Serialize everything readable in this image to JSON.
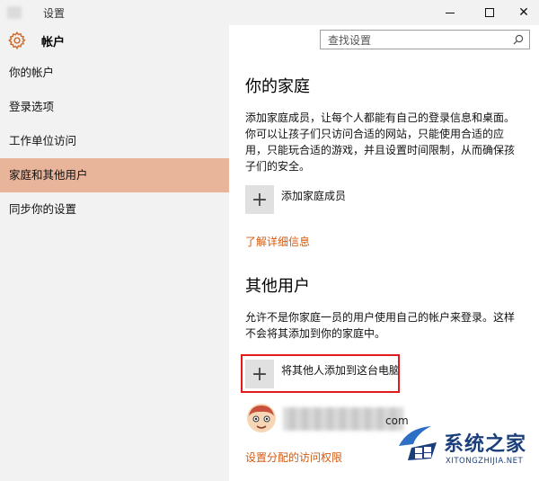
{
  "window": {
    "title": "设置",
    "controls": {
      "minimize": "minimize-icon",
      "maximize": "maximize-icon",
      "close": "✕"
    }
  },
  "sidebar": {
    "section_icon": "gear-icon",
    "section_title": "帐户",
    "items": [
      {
        "label": "你的帐户",
        "active": false
      },
      {
        "label": "登录选项",
        "active": false
      },
      {
        "label": "工作单位访问",
        "active": false
      },
      {
        "label": "家庭和其他用户",
        "active": true
      },
      {
        "label": "同步你的设置",
        "active": false
      }
    ]
  },
  "search": {
    "placeholder": "查找设置",
    "icon": "search-icon"
  },
  "family": {
    "heading": "你的家庭",
    "description_lines": [
      "添加家庭成员，让每个人都能有自己的登录信息和桌面。",
      "你可以让孩子们只访问合适的网站，只能使用合适的应",
      "用，只能玩合适的游戏，并且设置时间限制，从而确保孩",
      "子们的安全。"
    ],
    "add_button_icon": "+",
    "add_button_label": "添加家庭成员",
    "learn_more_link": "了解详细信息"
  },
  "others": {
    "heading": "其他用户",
    "description_lines": [
      "允许不是你家庭一员的用户使用自己的帐户来登录。这样",
      "不会将其添加到你的家庭中。"
    ],
    "add_button_icon": "+",
    "add_button_label": "将其他人添加到这台电脑",
    "user_email_suffix": "com",
    "assigned_access_link": "设置分配的访问权限"
  },
  "watermark": {
    "title": "系统之家",
    "url": "XITONGZHIJIA.NET"
  },
  "colors": {
    "accent_link": "#d45a10",
    "active_nav": "#e8b49a",
    "highlight_border": "#e01b1b",
    "pane_bg": "#f2f2f2"
  }
}
